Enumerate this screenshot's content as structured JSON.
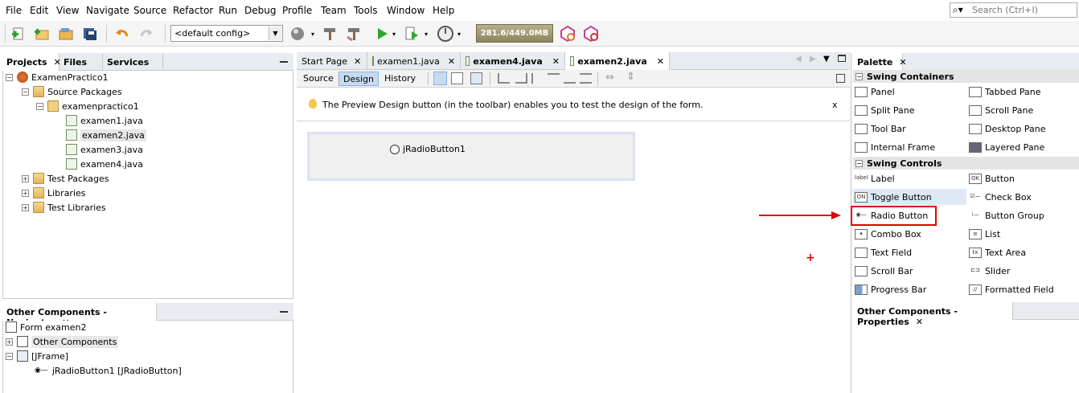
{
  "menubar": {
    "items": [
      "File",
      "Edit",
      "View",
      "Navigate",
      "Source",
      "Refactor",
      "Run",
      "Debug",
      "Profile",
      "Team",
      "Tools",
      "Window",
      "Help"
    ],
    "search_placeholder": "Search (Ctrl+I)"
  },
  "toolbar": {
    "config": "<default config>",
    "memory": "281.6/449.0MB"
  },
  "projects_panel": {
    "tabs": [
      "Projects",
      "Files",
      "Services"
    ],
    "tree": [
      {
        "label": "ExamenPractico1",
        "icon": "project-icon"
      },
      {
        "label": "Source Packages",
        "icon": "folder-icon"
      },
      {
        "label": "examenpractico1",
        "icon": "package-icon"
      },
      {
        "label": "examen1.java",
        "icon": "java-file-icon"
      },
      {
        "label": "examen2.java",
        "icon": "java-file-icon"
      },
      {
        "label": "examen3.java",
        "icon": "java-file-icon"
      },
      {
        "label": "examen4.java",
        "icon": "java-file-icon"
      },
      {
        "label": "Test Packages",
        "icon": "folder-icon"
      },
      {
        "label": "Libraries",
        "icon": "folder-icon"
      },
      {
        "label": "Test Libraries",
        "icon": "folder-icon"
      }
    ]
  },
  "navigator_panel": {
    "title": "Other Components - Navigator",
    "tree": [
      {
        "label": "Form examen2"
      },
      {
        "label": "Other Components"
      },
      {
        "label": "[JFrame]"
      },
      {
        "label": "jRadioButton1 [JRadioButton]"
      }
    ]
  },
  "editor": {
    "tabs": [
      "Start Page",
      "examen1.java",
      "examen4.java",
      "examen2.java"
    ],
    "views": [
      "Source",
      "Design",
      "History"
    ],
    "hint": "The Preview Design button (in the toolbar) enables you to test the design of the form.",
    "hint_close": "x",
    "component_label": "jRadioButton1",
    "plus_mark": "+"
  },
  "palette": {
    "title": "Palette",
    "categories": [
      {
        "name": "Swing Containers"
      },
      {
        "name": "Swing Controls"
      }
    ],
    "containers": [
      "Panel",
      "Tabbed Pane",
      "Split Pane",
      "Scroll Pane",
      "Tool Bar",
      "Desktop Pane",
      "Internal Frame",
      "Layered Pane"
    ],
    "controls": [
      "Label",
      "Button",
      "Toggle Button",
      "Check Box",
      "Radio Button",
      "Button Group",
      "Combo Box",
      "List",
      "Text Field",
      "Text Area",
      "Scroll Bar",
      "Slider",
      "Progress Bar",
      "Formatted Field"
    ],
    "control_icons": [
      "label",
      "OK",
      "ON",
      "",
      "",
      "",
      "",
      "",
      "",
      "tx",
      "",
      "",
      "",
      ""
    ]
  },
  "properties_panel": {
    "title": "Other Components - Properties"
  },
  "colors": {
    "annotation": "#e00000"
  }
}
